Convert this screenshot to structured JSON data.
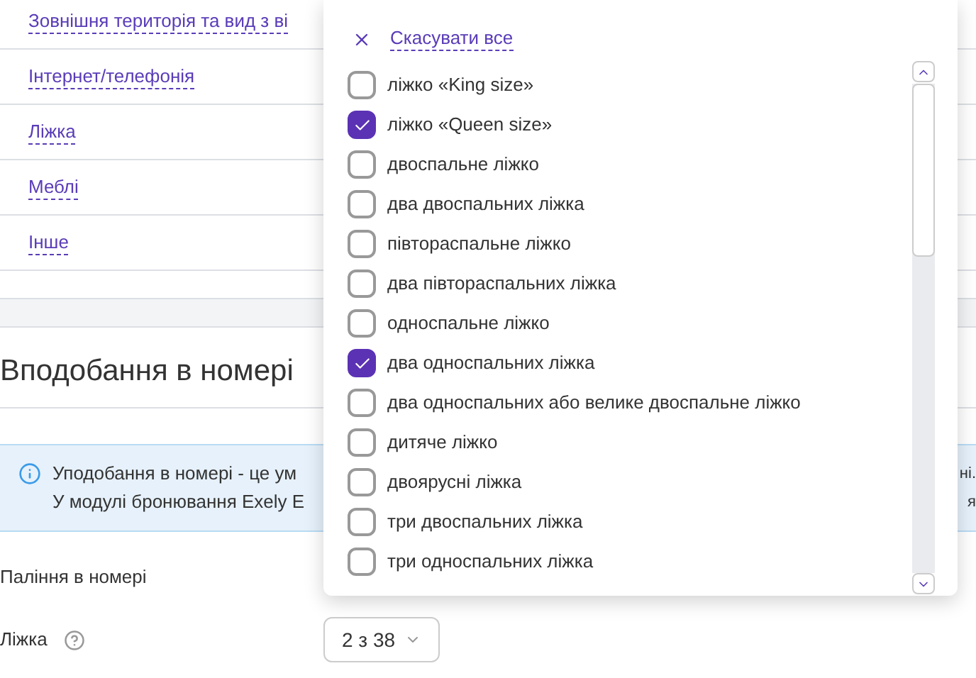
{
  "category_links": [
    {
      "label": "Зовнішня територія та вид з ві"
    },
    {
      "label": "Інтернет/телефонія"
    },
    {
      "label": "Ліжка"
    },
    {
      "label": "Меблі"
    },
    {
      "label": "Інше"
    }
  ],
  "section": {
    "title": "Вподобання в номері"
  },
  "info_banner": {
    "lines": [
      {
        "left": "Уподобання в номері - це ум",
        "right": "ні."
      },
      {
        "left": "У модулі бронювання Exely E",
        "right": "я"
      }
    ]
  },
  "fields": [
    {
      "label": "Паління в номері"
    },
    {
      "label": "Ліжка",
      "selector": "2 з 38"
    }
  ],
  "dropdown": {
    "clear_all": "Скасувати все",
    "options": [
      {
        "label": "ліжко «King size»",
        "checked": false
      },
      {
        "label": "ліжко «Queen size»",
        "checked": true
      },
      {
        "label": "двоспальне ліжко",
        "checked": false
      },
      {
        "label": "два двоспальних ліжка",
        "checked": false
      },
      {
        "label": "півтораспальне ліжко",
        "checked": false
      },
      {
        "label": "два півтораспальних ліжка",
        "checked": false
      },
      {
        "label": "односпальне ліжко",
        "checked": false
      },
      {
        "label": "два односпальних ліжка",
        "checked": true
      },
      {
        "label": "два односпальних або велике двоспальне ліжко",
        "checked": false
      },
      {
        "label": "дитяче ліжко",
        "checked": false
      },
      {
        "label": "двоярусні ліжка",
        "checked": false
      },
      {
        "label": "три двоспальних ліжка",
        "checked": false
      },
      {
        "label": "три односпальних ліжка",
        "checked": false
      }
    ]
  }
}
